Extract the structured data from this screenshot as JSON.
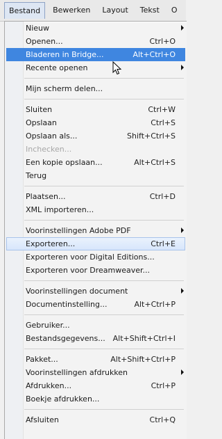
{
  "menubar": {
    "items": [
      "Bestand",
      "Bewerken",
      "Layout",
      "Tekst",
      "O"
    ]
  },
  "menu": {
    "groups": [
      {
        "items": [
          {
            "label": "Nieuw",
            "shortcut": "",
            "submenu": true
          },
          {
            "label": "Openen...",
            "shortcut": "Ctrl+O"
          },
          {
            "label": "Bladeren in Bridge...",
            "shortcut": "Alt+Ctrl+O",
            "state": "highlighted"
          },
          {
            "label": "Recente openen",
            "shortcut": "",
            "submenu": true
          }
        ]
      },
      {
        "items": [
          {
            "label": "Mijn scherm delen...",
            "shortcut": ""
          }
        ]
      },
      {
        "items": [
          {
            "label": "Sluiten",
            "shortcut": "Ctrl+W"
          },
          {
            "label": "Opslaan",
            "shortcut": "Ctrl+S"
          },
          {
            "label": "Opslaan als...",
            "shortcut": "Shift+Ctrl+S"
          },
          {
            "label": "Inchecken...",
            "shortcut": "",
            "disabled": true
          },
          {
            "label": "Een kopie opslaan...",
            "shortcut": "Alt+Ctrl+S"
          },
          {
            "label": "Terug",
            "shortcut": ""
          }
        ]
      },
      {
        "items": [
          {
            "label": "Plaatsen...",
            "shortcut": "Ctrl+D"
          },
          {
            "label": "XML importeren...",
            "shortcut": ""
          }
        ]
      },
      {
        "items": [
          {
            "label": "Voorinstellingen Adobe PDF",
            "shortcut": "",
            "submenu": true
          },
          {
            "label": "Exporteren...",
            "shortcut": "Ctrl+E",
            "state": "hover"
          },
          {
            "label": "Exporteren voor Digital Editions...",
            "shortcut": ""
          },
          {
            "label": "Exporteren voor Dreamweaver...",
            "shortcut": ""
          }
        ]
      },
      {
        "items": [
          {
            "label": "Voorinstellingen document",
            "shortcut": "",
            "submenu": true
          },
          {
            "label": "Documentinstelling...",
            "shortcut": "Alt+Ctrl+P"
          }
        ]
      },
      {
        "items": [
          {
            "label": "Gebruiker...",
            "shortcut": ""
          },
          {
            "label": "Bestandsgegevens...",
            "shortcut": "Alt+Shift+Ctrl+I"
          }
        ]
      },
      {
        "items": [
          {
            "label": "Pakket...",
            "shortcut": "Alt+Shift+Ctrl+P"
          },
          {
            "label": "Voorinstellingen afdrukken",
            "shortcut": "",
            "submenu": true
          },
          {
            "label": "Afdrukken...",
            "shortcut": "Ctrl+P"
          },
          {
            "label": "Boekje afdrukken...",
            "shortcut": ""
          }
        ]
      },
      {
        "items": [
          {
            "label": "Afsluiten",
            "shortcut": "Ctrl+Q"
          }
        ]
      }
    ]
  },
  "icons": {
    "cursor": "mouse-pointer-icon",
    "submenu": "chevron-right-icon"
  },
  "colors": {
    "highlight": "#3f86e0",
    "hover": "#d7e6fb",
    "disabled": "#a7a7a7"
  }
}
